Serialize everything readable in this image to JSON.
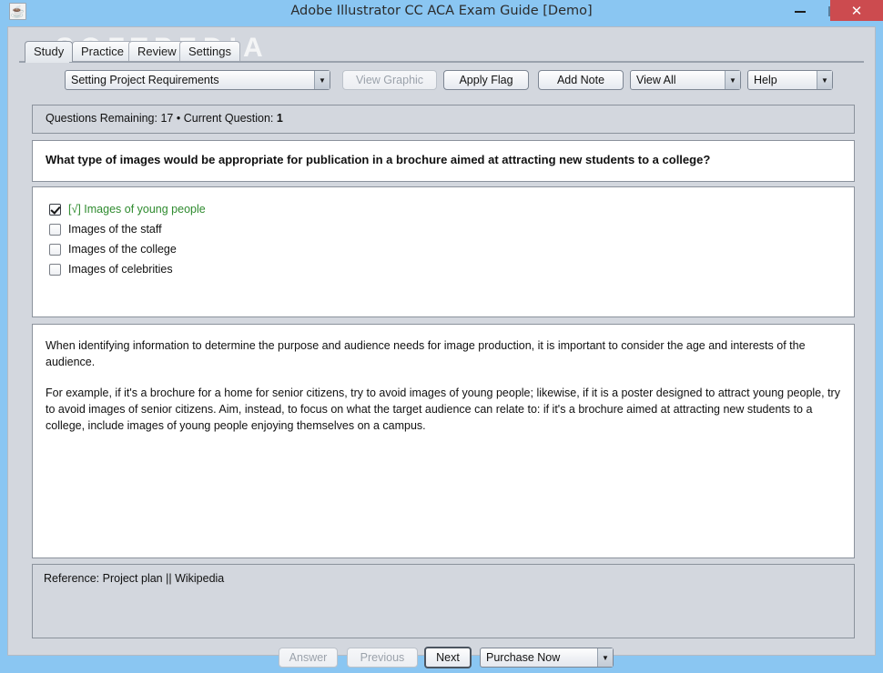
{
  "window": {
    "title": "Adobe Illustrator CC ACA Exam Guide [Demo]",
    "app_icon": "java-coffee-cup-icon",
    "minimize_label": "–",
    "maximize_label": "□",
    "close_label": "✕",
    "watermark": "SOFTPEDIA",
    "frame_color": "#8ac6f2",
    "close_button_color": "#cc4b4f",
    "panel_color": "#d3d7de"
  },
  "tabs": [
    {
      "label": "Study",
      "active": true
    },
    {
      "label": "Practice",
      "active": false
    },
    {
      "label": "Review",
      "active": false
    },
    {
      "label": "Settings",
      "active": false
    }
  ],
  "toolbar": {
    "topic_combo": {
      "value": "Setting Project Requirements",
      "arrow": "▼"
    },
    "view_graphic_button": {
      "label": "View Graphic",
      "disabled": true
    },
    "apply_flag_button": {
      "label": "Apply Flag",
      "disabled": false
    },
    "add_note_button": {
      "label": "Add Note",
      "disabled": false
    },
    "view_all_combo": {
      "value": "View All",
      "arrow": "▼"
    },
    "help_combo": {
      "value": "Help",
      "arrow": "▼"
    }
  },
  "status": {
    "questions_remaining_label": "Questions Remaining:",
    "questions_remaining_value": "17",
    "separator": "•",
    "current_question_label": "Current Question:",
    "current_question_value": "1",
    "full_text": "Questions Remaining: 17 • Current Question: 1"
  },
  "question": {
    "text": "What type of images would be appropriate for publication in a brochure aimed at attracting new students to a college?"
  },
  "answers": [
    {
      "label": "[√] Images of young people",
      "checked": true,
      "correct": true
    },
    {
      "label": "Images of the staff",
      "checked": false,
      "correct": false
    },
    {
      "label": "Images of the college",
      "checked": false,
      "correct": false
    },
    {
      "label": "Images of celebrities",
      "checked": false,
      "correct": false
    }
  ],
  "answer_correct_color": "#2f8b2f",
  "explanation": {
    "paragraphs": [
      "When identifying information to determine the purpose and audience needs for image production, it is important to consider the age and interests of the audience.",
      "For example, if it's a brochure for a home for senior citizens, try to avoid images of young people; likewise, if it is a poster designed to attract young people, try to avoid images of senior citizens. Aim, instead, to focus on what the target audience can relate to: if it's a brochure aimed at attracting new students to a college, include images of young people enjoying themselves on a campus."
    ]
  },
  "reference": {
    "text": "Reference:  Project plan || Wikipedia"
  },
  "footer": {
    "answer_button": {
      "label": "Answer",
      "disabled": true
    },
    "previous_button": {
      "label": "Previous",
      "disabled": true
    },
    "next_button": {
      "label": "Next",
      "disabled": false
    },
    "purchase_combo": {
      "value": "Purchase Now",
      "arrow": "▼"
    }
  }
}
